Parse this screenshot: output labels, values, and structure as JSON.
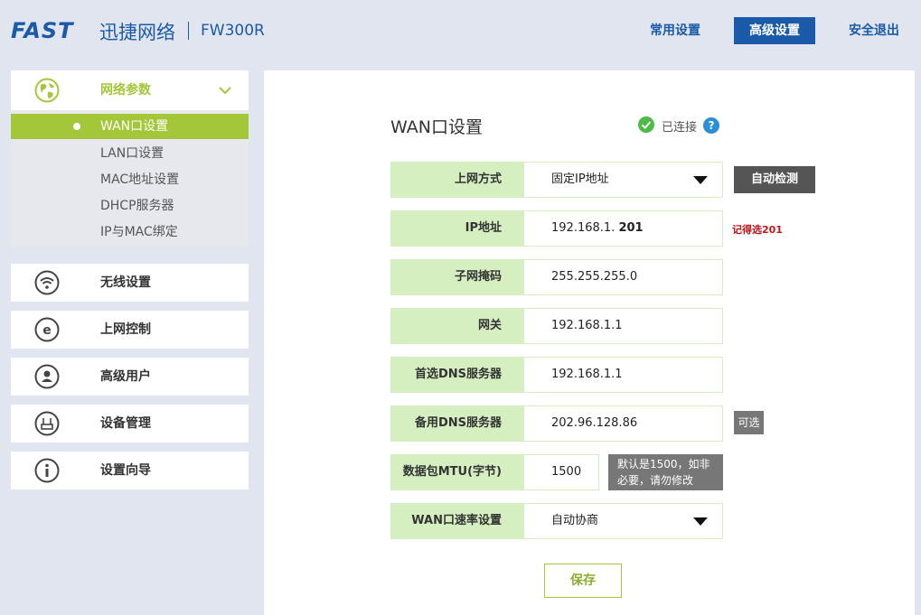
{
  "header": {
    "logo": "FAST",
    "brand_cn": "迅捷网络",
    "model": "FW300R",
    "nav": {
      "common": "常用设置",
      "advanced": "高级设置",
      "exit": "安全退出"
    }
  },
  "sidebar": {
    "network": {
      "label": "网络参数",
      "subitems": [
        "WAN口设置",
        "LAN口设置",
        "MAC地址设置",
        "DHCP服务器",
        "IP与MAC绑定"
      ]
    },
    "items": [
      {
        "label": "无线设置",
        "icon": "wifi-icon"
      },
      {
        "label": "上网控制",
        "icon": "internet-e-icon"
      },
      {
        "label": "高级用户",
        "icon": "user-icon"
      },
      {
        "label": "设备管理",
        "icon": "router-icon"
      },
      {
        "label": "设置向导",
        "icon": "info-icon"
      }
    ]
  },
  "main": {
    "title": "WAN口设置",
    "status": "已连接",
    "help": "?",
    "rows": [
      {
        "label": "上网方式",
        "value": "固定IP地址"
      },
      {
        "label": "IP地址",
        "value_prefix": "192.168.1. ",
        "value_bold": "201"
      },
      {
        "label": "子网掩码",
        "value": "255.255.255.0"
      },
      {
        "label": "网关",
        "value": "192.168.1.1"
      },
      {
        "label": "首选DNS服务器",
        "value": "192.168.1.1"
      },
      {
        "label": "备用DNS服务器",
        "value": "202.96.128.86"
      },
      {
        "label": "数据包MTU(字节)",
        "value": "1500"
      },
      {
        "label": "WAN口速率设置",
        "value": "自动协商"
      }
    ],
    "detect_button": "自动检测",
    "note_ip": "记得选201",
    "note_optional": "可选",
    "note_mtu": "默认是1500，如非必要，请勿修改",
    "save_button": "保存"
  },
  "colors": {
    "brand_blue": "#1a5aa8",
    "accent_green": "#a4c639",
    "label_bg": "#d5efc1",
    "note_red": "#c0161c"
  }
}
